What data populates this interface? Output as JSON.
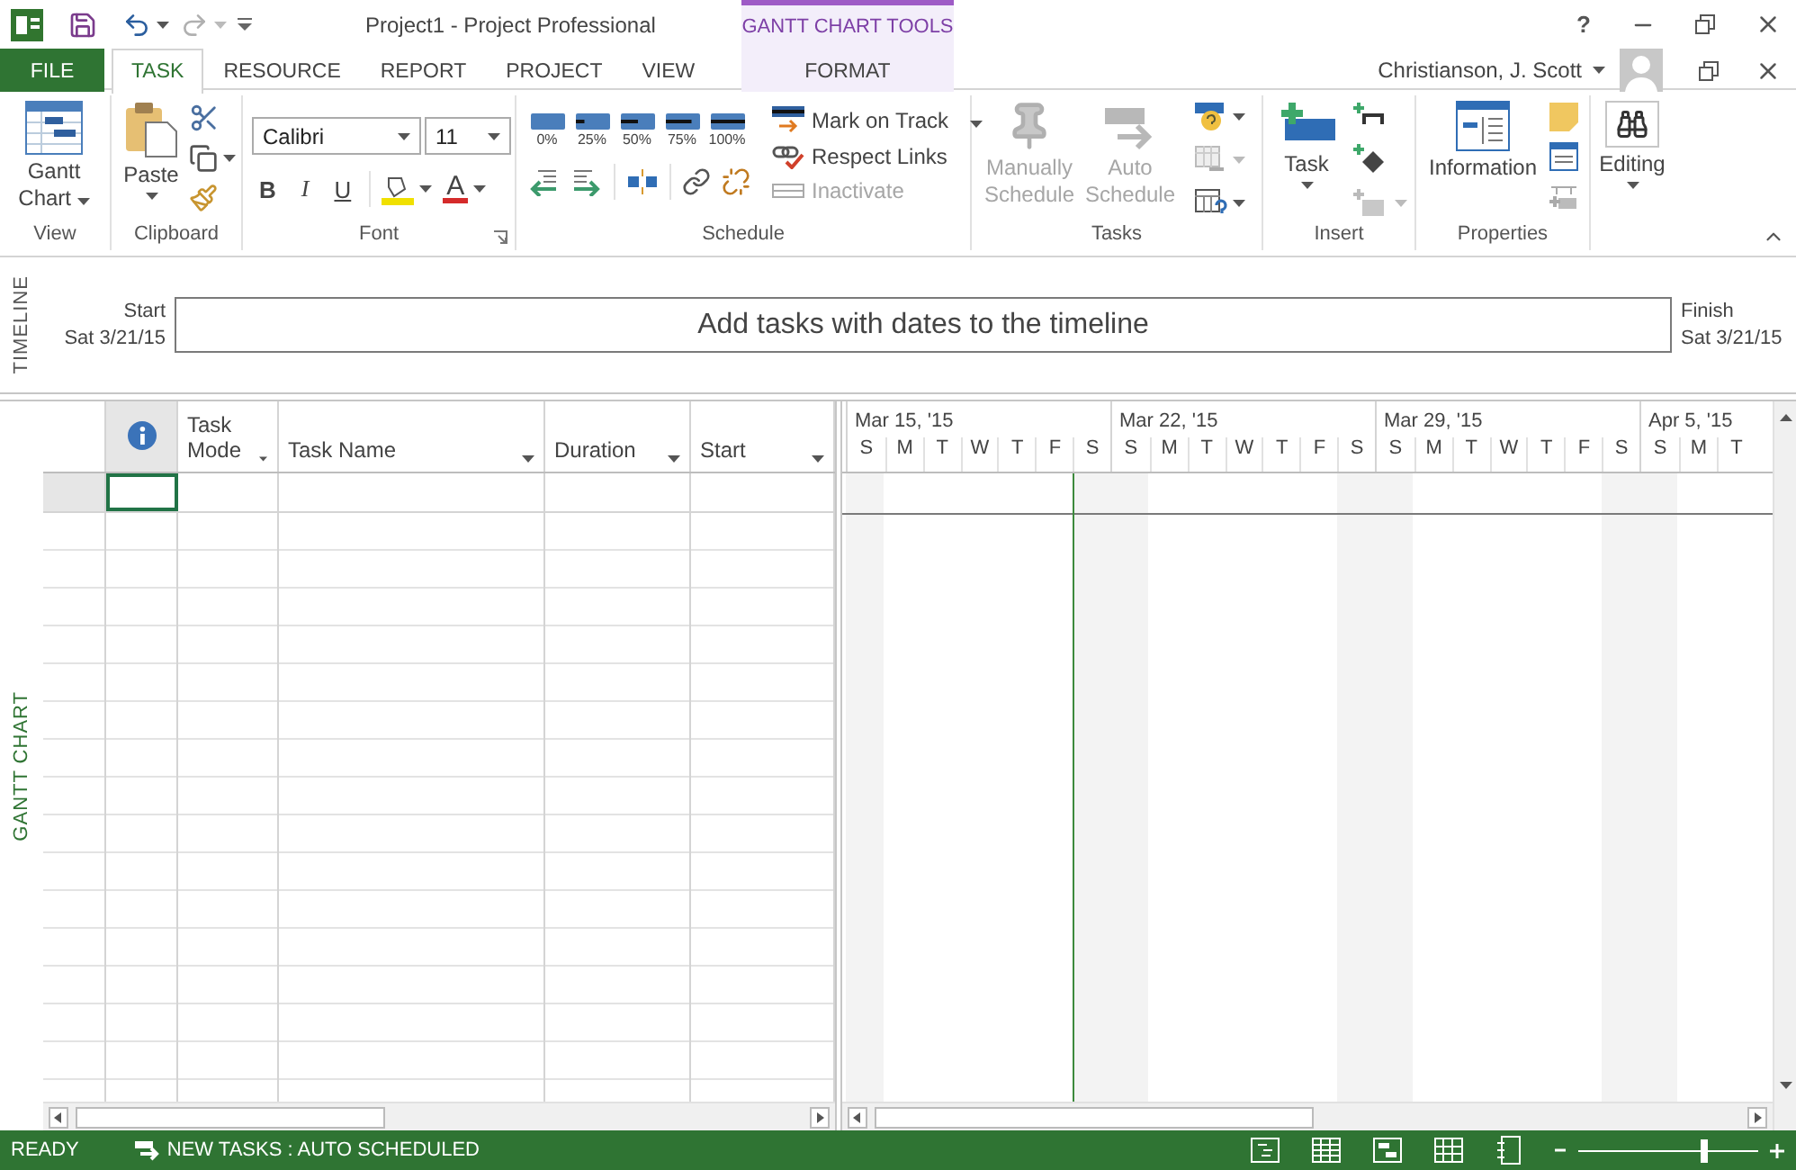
{
  "window": {
    "title": "Project1 - Project Professional",
    "help": "?"
  },
  "contextual_tabs": {
    "label": "GANTT CHART TOOLS"
  },
  "tabs": [
    {
      "label": "FILE",
      "kind": "file",
      "selected": false
    },
    {
      "label": "TASK",
      "kind": "tab",
      "selected": true
    },
    {
      "label": "RESOURCE",
      "kind": "tab",
      "selected": false
    },
    {
      "label": "REPORT",
      "kind": "tab",
      "selected": false
    },
    {
      "label": "PROJECT",
      "kind": "tab",
      "selected": false
    },
    {
      "label": "VIEW",
      "kind": "tab",
      "selected": false
    },
    {
      "label": "FORMAT",
      "kind": "contextual",
      "selected": false
    }
  ],
  "account": {
    "name": "Christianson, J. Scott"
  },
  "ribbon": {
    "view": {
      "label": "View",
      "gantt_chart": "Gantt Chart"
    },
    "clipboard": {
      "label": "Clipboard",
      "paste": "Paste"
    },
    "font": {
      "label": "Font",
      "font_name": "Calibri",
      "font_size": "11",
      "bold": "B",
      "italic": "I",
      "underline": "U",
      "font_color": "A"
    },
    "schedule": {
      "label": "Schedule",
      "percent_complete": [
        "0%",
        "25%",
        "50%",
        "75%",
        "100%"
      ],
      "mark_on_track": "Mark on Track",
      "respect_links": "Respect Links",
      "inactivate": {
        "label": "Inactivate",
        "disabled": true
      }
    },
    "tasks": {
      "label": "Tasks",
      "manually_schedule": {
        "label": "Manually Schedule",
        "disabled": true
      },
      "auto_schedule": {
        "label": "Auto Schedule",
        "disabled": true
      }
    },
    "insert": {
      "label": "Insert",
      "task": "Task"
    },
    "properties": {
      "label": "Properties",
      "information": "Information"
    },
    "editing": {
      "label": "Editing"
    }
  },
  "timeline": {
    "label": "TIMELINE",
    "start_label": "Start",
    "start_date": "Sat 3/21/15",
    "placeholder": "Add tasks with dates to the timeline",
    "finish_label": "Finish",
    "finish_date": "Sat 3/21/15"
  },
  "gantt": {
    "label": "GANTT CHART",
    "columns": [
      {
        "kind": "info"
      },
      {
        "kind": "text",
        "label": "Task Mode"
      },
      {
        "kind": "text",
        "label": "Task Name"
      },
      {
        "kind": "text",
        "label": "Duration"
      },
      {
        "kind": "text",
        "label": "Start"
      }
    ],
    "weeks": [
      {
        "label": "Mar 15, '15",
        "days": [
          "S",
          "M",
          "T",
          "W",
          "T",
          "F",
          "S"
        ]
      },
      {
        "label": "Mar 22, '15",
        "days": [
          "S",
          "M",
          "T",
          "W",
          "T",
          "F",
          "S"
        ]
      },
      {
        "label": "Mar 29, '15",
        "days": [
          "S",
          "M",
          "T",
          "W",
          "T",
          "F",
          "S"
        ]
      },
      {
        "label": "Apr 5, '15",
        "days": [
          "S",
          "M",
          "T"
        ]
      }
    ]
  },
  "status_bar": {
    "mode": "READY",
    "new_tasks": "NEW TASKS : AUTO SCHEDULED",
    "zoom": {
      "level": 0.7
    }
  }
}
